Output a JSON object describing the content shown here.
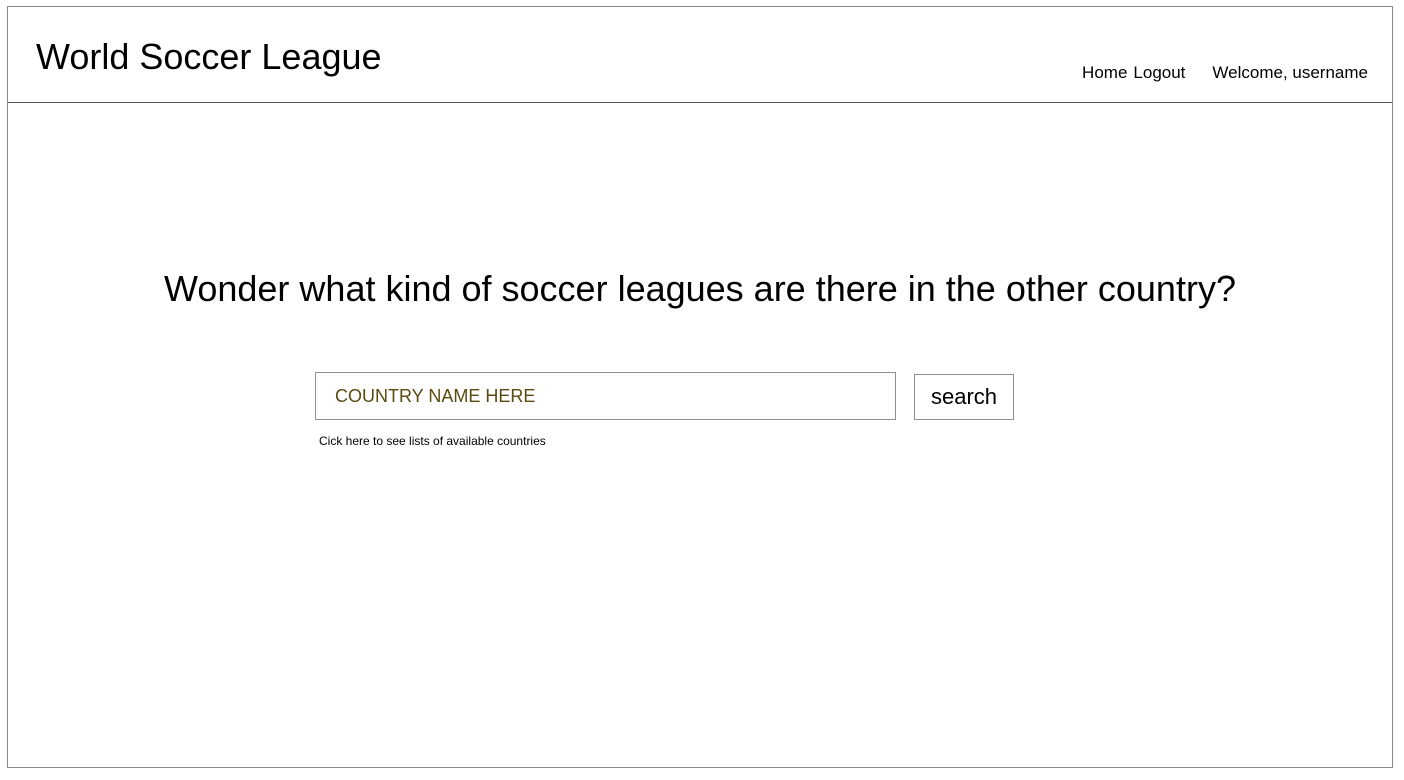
{
  "header": {
    "title": "World Soccer League",
    "nav": {
      "home_label": "Home",
      "logout_label": "Logout",
      "welcome_text": "Welcome, username"
    }
  },
  "main": {
    "headline": "Wonder what kind of soccer leagues are there in the other country?",
    "search": {
      "placeholder": "COUNTRY NAME HERE",
      "button_label": "search"
    },
    "countries_link": "Cick here to see lists of available countries"
  },
  "colors": {
    "border": "#8f8f8f",
    "header_divider": "#555555",
    "placeholder_text": "#5a4a10"
  }
}
